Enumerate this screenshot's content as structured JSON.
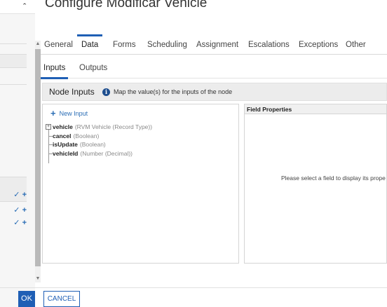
{
  "modal": {
    "title": "Configure Modificar Vehicle"
  },
  "tabs": [
    {
      "label": "General"
    },
    {
      "label": "Data"
    },
    {
      "label": "Forms"
    },
    {
      "label": "Scheduling"
    },
    {
      "label": "Assignment"
    },
    {
      "label": "Escalations"
    },
    {
      "label": "Exceptions"
    },
    {
      "label": "Other"
    }
  ],
  "active_tab": "Data",
  "subtabs": [
    {
      "label": "Inputs"
    },
    {
      "label": "Outputs"
    }
  ],
  "active_subtab": "Inputs",
  "section": {
    "title": "Node Inputs",
    "info_icon": "info-icon",
    "info_text": "Map the value(s) for the inputs of the node"
  },
  "inputs_panel": {
    "new_input_label": "New Input",
    "new_input_icon": "plus-icon",
    "items": [
      {
        "name": "vehicle",
        "type": "(RVM Vehicle (Record Type))",
        "expandable": true
      },
      {
        "name": "cancel",
        "type": "(Boolean)",
        "expandable": false
      },
      {
        "name": "isUpdate",
        "type": "(Boolean)",
        "expandable": false
      },
      {
        "name": "vehicleId",
        "type": "(Number (Decimal))",
        "expandable": false
      }
    ]
  },
  "props_panel": {
    "header": "Field Properties",
    "empty_message": "Please select a field to display its prope"
  },
  "footer": {
    "ok_label": "OK",
    "cancel_label": "CANCEL"
  },
  "colors": {
    "accent": "#1f5fb5",
    "link": "#2a6db5",
    "section_bg": "#ececec"
  }
}
